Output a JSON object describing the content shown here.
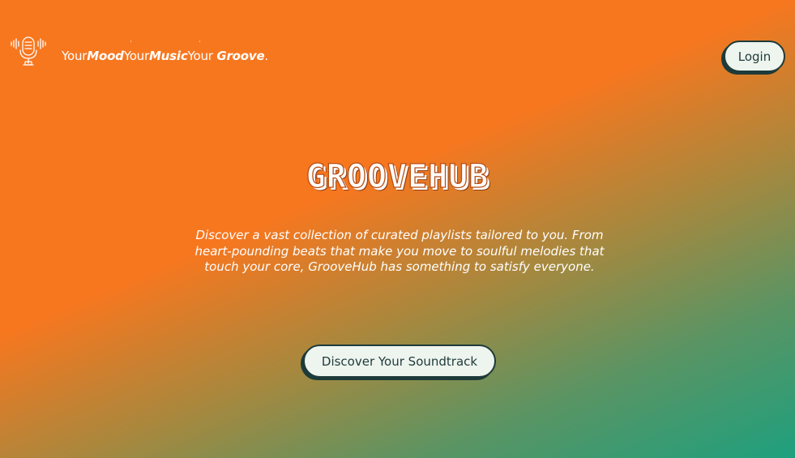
{
  "header": {
    "logo_icon": "microphone-soundwave-icon",
    "tagline": {
      "your1": "Your",
      "mood": "Mood",
      "your2": "Your",
      "music": "Music",
      "your3": "Your",
      "groove": "Groove",
      "period": "."
    },
    "login_label": "Login"
  },
  "hero": {
    "title": "GROOVEHUB",
    "description": "Discover a vast collection of curated playlists tailored to you. From heart-pounding beats that make you move to soulful melodies that touch your core, GrooveHub has something to satisfy everyone.",
    "cta_label": "Discover Your Soundtrack"
  },
  "colors": {
    "background_start": "#f7771f",
    "background_end": "#1ea07e",
    "button_bg": "#eef4ee",
    "button_border": "#1e3b3a"
  }
}
